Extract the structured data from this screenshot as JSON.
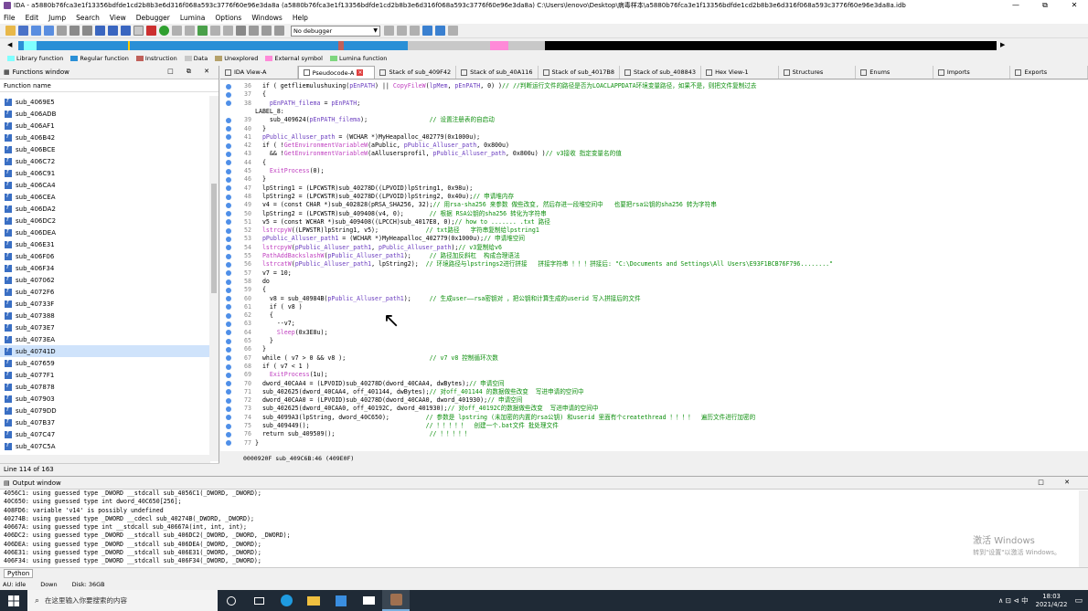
{
  "title": "IDA - a5880b76fca3e1f13356bdfde1cd2b8b3e6d316f068a593c3776f60e96e3da8a (a5880b76fca3e1f13356bdfde1cd2b8b3e6d316f068a593c3776f60e96e3da8a) C:\\Users\\lenovo\\Desktop\\病毒样本\\a5880b76fca3e1f13356bdfde1cd2b8b3e6d316f068a593c3776f60e96e3da8a.idb",
  "window_controls": {
    "min": "—",
    "max": "⧉",
    "close": "✕"
  },
  "menu": [
    "File",
    "Edit",
    "Jump",
    "Search",
    "View",
    "Debugger",
    "Lumina",
    "Options",
    "Windows",
    "Help"
  ],
  "debugger_select": "No debugger",
  "legend": [
    {
      "label": "Library function",
      "color": "#80ffff"
    },
    {
      "label": "Regular function",
      "color": "#2a8fd6"
    },
    {
      "label": "Instruction",
      "color": "#c0605a"
    },
    {
      "label": "Data",
      "color": "#c8c8c8"
    },
    {
      "label": "Unexplored",
      "color": "#b5a16a"
    },
    {
      "label": "External symbol",
      "color": "#ff8ad8"
    },
    {
      "label": "Lumina function",
      "color": "#7ed67e"
    }
  ],
  "functions_window": {
    "title": "Functions window",
    "column": "Function name",
    "items": [
      "sub_4069E5",
      "sub_406ADB",
      "sub_406AF1",
      "sub_406B42",
      "sub_406BCE",
      "sub_406C72",
      "sub_406C91",
      "sub_406CA4",
      "sub_406CEA",
      "sub_406DA2",
      "sub_406DC2",
      "sub_406DEA",
      "sub_406E31",
      "sub_406F06",
      "sub_406F34",
      "sub_407062",
      "sub_4072F6",
      "sub_40733F",
      "sub_407388",
      "sub_4073E7",
      "sub_4073EA",
      "sub_40741D",
      "sub_407659",
      "sub_4077F1",
      "sub_407878",
      "sub_407903",
      "sub_4079DD",
      "sub_407B37",
      "sub_407C47",
      "sub_407C5A"
    ],
    "selected_index": 21,
    "line_status": "Line 114 of 163"
  },
  "tabs": [
    {
      "label": "IDA View-A",
      "active": false
    },
    {
      "label": "Pseudocode-A",
      "active": true
    },
    {
      "label": "Stack of sub_409F42",
      "active": false
    },
    {
      "label": "Stack of sub_40A116",
      "active": false
    },
    {
      "label": "Stack of sub_4017B8",
      "active": false
    },
    {
      "label": "Stack of sub_408843",
      "active": false
    },
    {
      "label": "Hex View-1",
      "active": false
    },
    {
      "label": "Structures",
      "active": false
    },
    {
      "label": "Enums",
      "active": false
    },
    {
      "label": "Imports",
      "active": false
    },
    {
      "label": "Exports",
      "active": false
    }
  ],
  "code_lines": [
    {
      "n": "36",
      "dot": true,
      "t": "  if ( getfliemulushuxing(pEnPATH) || CopyFileW(lpMem, pEnPATH, 0) )// //判断运行文件的路径是否为LOACLAPPDATA环境变量路径，如果不是，则把文件复制过去"
    },
    {
      "n": "37",
      "dot": true,
      "t": "  {"
    },
    {
      "n": "38",
      "dot": true,
      "t": "    pEnPATH_filema = pEnPATH;"
    },
    {
      "n": "",
      "dot": false,
      "t": "LABEL_8:"
    },
    {
      "n": "39",
      "dot": true,
      "t": "    sub_409624(pEnPATH_filema);                 // 设置注册表的自启动"
    },
    {
      "n": "40",
      "dot": true,
      "t": "  }"
    },
    {
      "n": "41",
      "dot": true,
      "t": "  pPublic_Alluser_path = (WCHAR *)MyHeapalloc_402779(0x1000u);"
    },
    {
      "n": "42",
      "dot": true,
      "t": "  if ( !GetEnvironmentVariableW(aPublic, pPublic_Alluser_path, 0x800u)"
    },
    {
      "n": "43",
      "dot": true,
      "t": "    && !GetEnvironmentVariableW(aAllusersprofil, pPublic_Alluser_path, 0x800u) )// v3接收 指定变量名的值"
    },
    {
      "n": "44",
      "dot": true,
      "t": "  {"
    },
    {
      "n": "45",
      "dot": true,
      "t": "    ExitProcess(0);"
    },
    {
      "n": "46",
      "dot": true,
      "t": "  }"
    },
    {
      "n": "47",
      "dot": true,
      "t": "  lpString1 = (LPCWSTR)sub_40278D((LPVOID)lpString1, 0x98u);"
    },
    {
      "n": "48",
      "dot": true,
      "t": "  lpString2 = (LPCWSTR)sub_40278D((LPVOID)lpString2, 0x40u);// 申请堆内存"
    },
    {
      "n": "49",
      "dot": true,
      "t": "  v4 = (const CHAR *)sub_402828(pRSA_SHA256, 32);// 用rsa-sha256 来参数 做些改变, 然后存进一段堆空间中   也要把rsa公钥的sha256 转为字符串"
    },
    {
      "n": "50",
      "dot": true,
      "t": "  lpString2 = (LPCWSTR)sub_409408(v4, 0);       // 根据 RSA公钥的sha256 转化为字符串"
    },
    {
      "n": "51",
      "dot": true,
      "t": "  v5 = (const WCHAR *)sub_409408((LPCCH)sub_4017E8, 0);// how to ....... .txt 路径"
    },
    {
      "n": "52",
      "dot": true,
      "t": "  lstrcpyW((LPWSTR)lpString1, v5);             // txt路径   字符串复制给lpstring1"
    },
    {
      "n": "53",
      "dot": true,
      "t": "  pPublic_Alluser_path1 = (WCHAR *)MyHeapalloc_402779(0x1000u);// 申请堆空间"
    },
    {
      "n": "54",
      "dot": true,
      "t": "  lstrcpyW(pPublic_Alluser_path1, pPublic_Alluser_path);// v3复制给v6"
    },
    {
      "n": "55",
      "dot": true,
      "t": "  PathAddBackslashW(pPublic_Alluser_path1);     // 路径加反斜杠  构成合理语法"
    },
    {
      "n": "56",
      "dot": true,
      "t": "  lstrcatW(pPublic_Alluser_path1, lpString2);  // 环境路径与lpstrings2进行拼接   拼接字符串 ！！！拼接后: \"C:\\Documents and Settings\\All Users\\E93F1BCB76F796........\""
    },
    {
      "n": "57",
      "dot": true,
      "t": "  v7 = 10;"
    },
    {
      "n": "58",
      "dot": true,
      "t": "  do"
    },
    {
      "n": "59",
      "dot": true,
      "t": "  {"
    },
    {
      "n": "60",
      "dot": true,
      "t": "    v8 = sub_40984B(pPublic_Alluser_path1);     // 生成user——rsa密钥对 ，把公钥和计算生成的userid 写入拼接后的文件"
    },
    {
      "n": "61",
      "dot": true,
      "t": "    if ( v8 )"
    },
    {
      "n": "62",
      "dot": true,
      "t": "    {"
    },
    {
      "n": "63",
      "dot": true,
      "t": "      --v7;"
    },
    {
      "n": "64",
      "dot": true,
      "t": "      Sleep(0x3E8u);"
    },
    {
      "n": "65",
      "dot": true,
      "t": "    }"
    },
    {
      "n": "66",
      "dot": true,
      "t": "  }"
    },
    {
      "n": "67",
      "dot": true,
      "t": "  while ( v7 > 0 && v8 );                       // v7 v8 控制循环次数"
    },
    {
      "n": "68",
      "dot": true,
      "t": "  if ( v7 < 1 )"
    },
    {
      "n": "69",
      "dot": true,
      "t": "    ExitProcess(1u);"
    },
    {
      "n": "70",
      "dot": true,
      "t": "  dword_40CAA4 = (LPVOID)sub_40278D(dword_40CAA4, dwBytes);// 申请空间"
    },
    {
      "n": "71",
      "dot": true,
      "t": "  sub_402625(dword_40CAA4, off_401144, dwBytes);// 对off_401144 的数据做些改变  写进申请的空间中"
    },
    {
      "n": "72",
      "dot": true,
      "t": "  dword_40CAA0 = (LPVOID)sub_40278D(dword_40CAA0, dword_401930);// 申请空间"
    },
    {
      "n": "73",
      "dot": true,
      "t": "  sub_402625(dword_40CAA0, off_40192C, dword_401930);// 对off_40192C的数据做些改变  写进申请的空间中"
    },
    {
      "n": "74",
      "dot": true,
      "t": "  sub_4099A3(lpString, dword_40C650);          // 参数是 lpstring (未加密的内置的rsa公钥) 和userid 里面有个createthread ！！！！  遍历文件进行加密的"
    },
    {
      "n": "75",
      "dot": true,
      "t": "  sub_409449();                                // ！！！！！  创建一个.bat文件 批处理文件"
    },
    {
      "n": "76",
      "dot": true,
      "t": "  return sub_409509();                          // ！！！！！"
    },
    {
      "n": "77",
      "dot": true,
      "t": "}"
    }
  ],
  "code_status": "0000920F sub_409C6B:46 (409E0F)",
  "output_window": {
    "title": "Output window",
    "lines": [
      "4056C1: using guessed type _DWORD __stdcall sub_4056C1(_DWORD, _DWORD);",
      "40C650: using guessed type int dword_40C650[256];",
      "408FD6: variable 'v14' is possibly undefined",
      "40274B: using guessed type _DWORD __cdecl sub_40274B(_DWORD, _DWORD);",
      "40667A: using guessed type int __stdcall sub_40667A(int, int, int);",
      "406DC2: using guessed type _DWORD __stdcall sub_406DC2(_DWORD, _DWORD, _DWORD);",
      "406DEA: using guessed type _DWORD __stdcall sub_406DEA(_DWORD, _DWORD);",
      "406E31: using guessed type _DWORD __stdcall sub_406E31(_DWORD, _DWORD);",
      "406F34: using guessed type _DWORD __stdcall sub_406F34(_DWORD, _DWORD);"
    ]
  },
  "watermark": {
    "line1": "激活 Windows",
    "line2": "转到\"设置\"以激活 Windows。"
  },
  "python_tab": "Python",
  "status": {
    "au": "AU:  idle",
    "dir": "Down",
    "disk": "Disk: 36GB"
  },
  "taskbar": {
    "search_placeholder": "在这里输入你要搜索的内容",
    "tray_text": "∧  ⊡  ⊲  中",
    "time": "18:03",
    "date": "2021/4/22"
  }
}
